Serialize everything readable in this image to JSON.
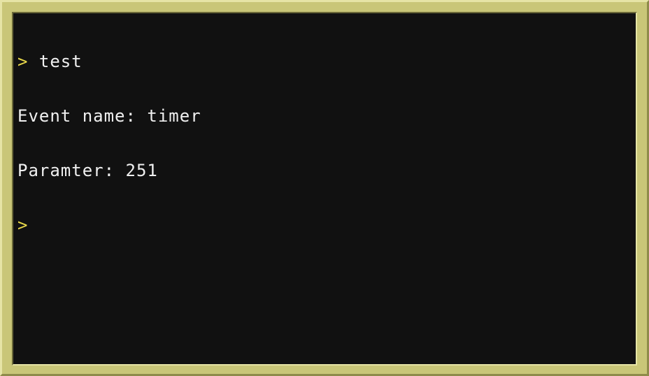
{
  "console": {
    "prompt_symbol": ">",
    "lines": [
      {
        "prompt": ">",
        "text": " test"
      },
      {
        "text": "Event name: timer"
      },
      {
        "text": "Paramter: 251"
      }
    ],
    "input_prompt": ">",
    "input_value": ""
  },
  "colors": {
    "frame": "#c9c678",
    "screen_bg": "#111111",
    "text": "#f0f0f0",
    "prompt": "#e8d84a"
  }
}
